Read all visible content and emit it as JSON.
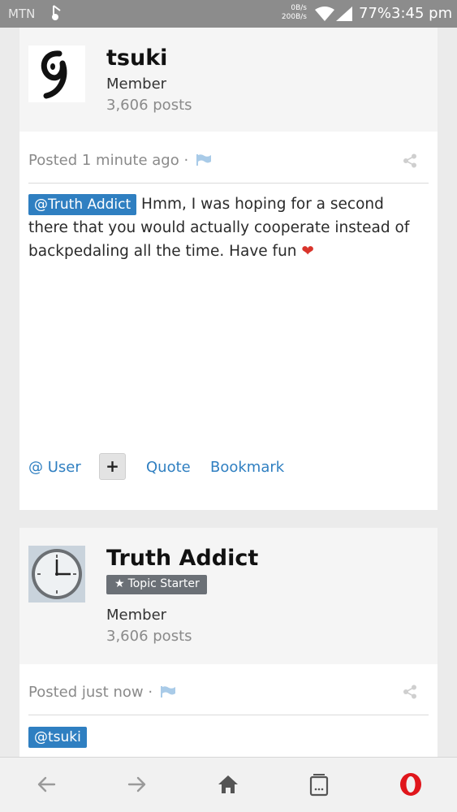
{
  "status_bar": {
    "carrier": "MTN",
    "net_up": "0B/s",
    "net_down": "200B/s",
    "battery": "77%",
    "time": "3:45 pm"
  },
  "posts": [
    {
      "author": "tsuki",
      "role": "Member",
      "post_count": "3,606 posts",
      "meta": "Posted 1 minute ago ·",
      "mention": "@Truth Addict",
      "body": "Hmm, I was hoping for a second there that you would actually cooperate instead of backpedaling all the time. Have fun",
      "reaction": "❤",
      "actions": {
        "user": "@ User",
        "plus": "+",
        "quote": "Quote",
        "bookmark": "Bookmark"
      }
    },
    {
      "author": "Truth Addict",
      "badge": "Topic Starter",
      "role": "Member",
      "post_count": "3,606 posts",
      "meta": "Posted just now ·",
      "mention": "@tsuki"
    }
  ],
  "colors": {
    "accent": "#2f7fc1",
    "badge": "#6b7076",
    "heart": "#d9342b",
    "opera": "#e0161c"
  },
  "icons": [
    "signal-icon",
    "wifi-icon",
    "flag-icon",
    "share-icon",
    "back-icon",
    "forward-icon",
    "home-icon",
    "tabs-icon",
    "opera-icon"
  ]
}
